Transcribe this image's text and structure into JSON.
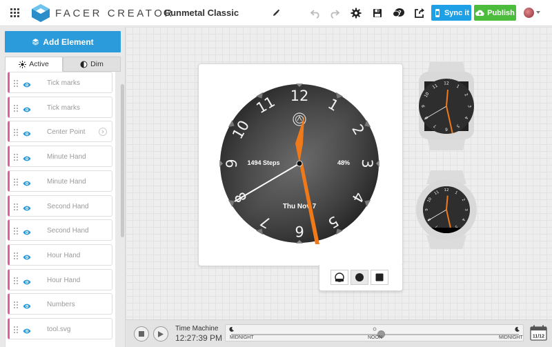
{
  "app": {
    "brand": "FACER CREATOR",
    "watch_title": "Gunmetal Classic"
  },
  "toolbar": {
    "sync_label": "Sync it",
    "publish_label": "Publish"
  },
  "sidebar": {
    "add_label": "Add Element",
    "tabs": [
      {
        "label": "Active"
      },
      {
        "label": "Dim"
      }
    ],
    "items": [
      {
        "label": "Tick marks"
      },
      {
        "label": "Tick marks"
      },
      {
        "label": "Center Point"
      },
      {
        "label": "Minute Hand"
      },
      {
        "label": "Minute Hand"
      },
      {
        "label": "Second Hand"
      },
      {
        "label": "Second Hand"
      },
      {
        "label": "Hour Hand"
      },
      {
        "label": "Hour Hand"
      },
      {
        "label": "Numbers"
      },
      {
        "label": "tool.svg"
      }
    ]
  },
  "watchface": {
    "steps": "1494 Steps",
    "battery": "48%",
    "date": "Thu Nov 7",
    "numerals": [
      "12",
      "1",
      "2",
      "3",
      "4",
      "5",
      "6",
      "7",
      "8",
      "9",
      "10",
      "11"
    ]
  },
  "time_machine": {
    "label": "Time Machine",
    "time": "12:27:39 PM",
    "midnight_left": "MIDNIGHT",
    "noon": "NOON",
    "midnight_right": "MIDNIGHT",
    "calendar_date": "11/12"
  },
  "colors": {
    "accent_blue": "#1ea0e6",
    "publish_green": "#4cbc3c",
    "hand_orange": "#f07a1a",
    "item_marker": "#e35aa5"
  }
}
